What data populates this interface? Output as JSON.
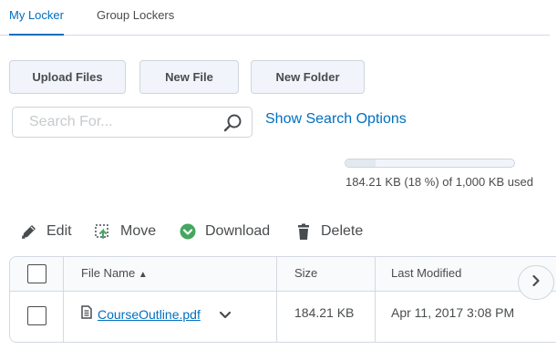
{
  "tabs": [
    {
      "label": "My Locker",
      "active": true
    },
    {
      "label": "Group Lockers",
      "active": false
    }
  ],
  "toolbar": {
    "upload_label": "Upload Files",
    "new_file_label": "New File",
    "new_folder_label": "New Folder"
  },
  "search": {
    "placeholder": "Search For...",
    "value": "",
    "options_link": "Show Search Options"
  },
  "usage": {
    "text": "184.21 KB (18 %) of 1,000 KB used",
    "fraction": 0.18
  },
  "actions": {
    "edit": "Edit",
    "move": "Move",
    "download": "Download",
    "delete": "Delete"
  },
  "table": {
    "columns": [
      "File Name",
      "Size",
      "Last Modified"
    ],
    "sort_indicator": "▲",
    "rows": [
      {
        "name": "CourseOutline.pdf",
        "size": "184.21 KB",
        "modified": "Apr 11, 2017 3:08 PM"
      }
    ]
  },
  "colors": {
    "accent": "#006fbf",
    "text": "#494c4e",
    "border": "#d3d9e3",
    "download_green": "#46a661"
  },
  "icons": {
    "search": "magnifier-icon",
    "edit": "pencil-icon",
    "move": "move-icon",
    "download": "download-icon",
    "delete": "trash-icon",
    "file": "document-icon",
    "scroll": "chevron-right-icon"
  }
}
